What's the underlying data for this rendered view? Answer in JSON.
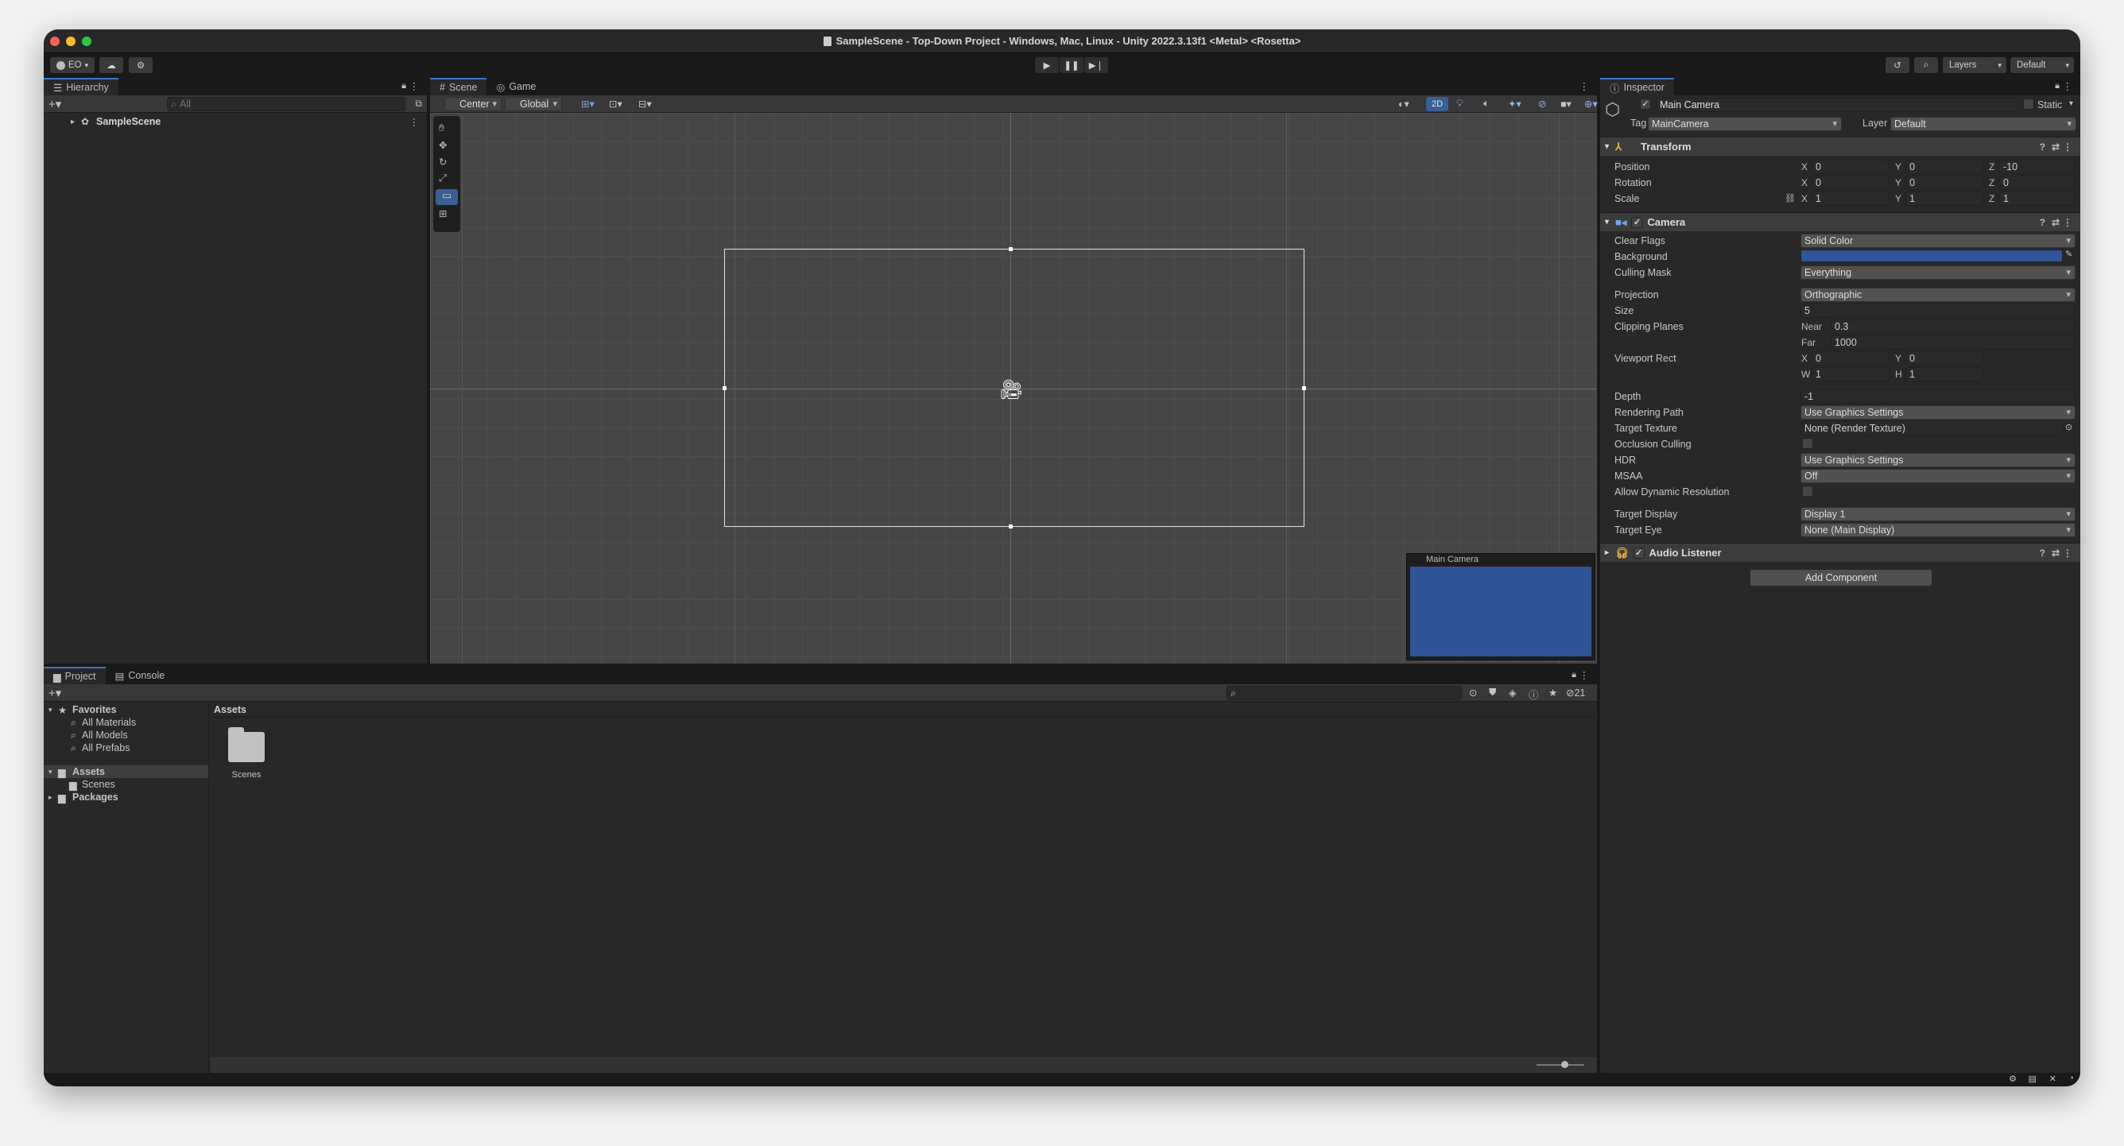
{
  "window": {
    "title": "SampleScene - Top-Down Project - Windows, Mac, Linux - Unity 2022.3.13f1 <Metal> <Rosetta>"
  },
  "toolbar": {
    "account": "EO",
    "layers": "Layers",
    "layout": "Default"
  },
  "hierarchy": {
    "tab": "Hierarchy",
    "search_placeholder": "All",
    "scene_item": "SampleScene"
  },
  "scene_view": {
    "tabs": [
      "Scene",
      "Game"
    ],
    "pivot": "Center",
    "space": "Global",
    "mode_2d": "2D",
    "camera_preview_title": "Main Camera",
    "camera_bg_color": "#2f5497"
  },
  "inspector": {
    "tab": "Inspector",
    "object_name": "Main Camera",
    "static_label": "Static",
    "tag_label": "Tag",
    "tag": "MainCamera",
    "layer_label": "Layer",
    "layer": "Default",
    "transform": {
      "title": "Transform",
      "rows": [
        {
          "label": "Position",
          "x": "0",
          "y": "0",
          "z": "-10"
        },
        {
          "label": "Rotation",
          "x": "0",
          "y": "0",
          "z": "0"
        },
        {
          "label": "Scale",
          "x": "1",
          "y": "1",
          "z": "1"
        }
      ]
    },
    "camera": {
      "title": "Camera",
      "clear_flags": {
        "label": "Clear Flags",
        "value": "Solid Color"
      },
      "background": {
        "label": "Background",
        "color": "#2f5497"
      },
      "culling_mask": {
        "label": "Culling Mask",
        "value": "Everything"
      },
      "projection": {
        "label": "Projection",
        "value": "Orthographic"
      },
      "size": {
        "label": "Size",
        "value": "5"
      },
      "clipping": {
        "label": "Clipping Planes",
        "near_label": "Near",
        "near": "0.3",
        "far_label": "Far",
        "far": "1000"
      },
      "viewport": {
        "label": "Viewport Rect",
        "x": "0",
        "y": "0",
        "w": "1",
        "h": "1"
      },
      "depth": {
        "label": "Depth",
        "value": "-1"
      },
      "rendering_path": {
        "label": "Rendering Path",
        "value": "Use Graphics Settings"
      },
      "target_texture": {
        "label": "Target Texture",
        "value": "None (Render Texture)"
      },
      "occlusion_culling": {
        "label": "Occlusion Culling"
      },
      "hdr": {
        "label": "HDR",
        "value": "Use Graphics Settings"
      },
      "msaa": {
        "label": "MSAA",
        "value": "Off"
      },
      "dynamic_res": {
        "label": "Allow Dynamic Resolution"
      },
      "target_display": {
        "label": "Target Display",
        "value": "Display 1"
      },
      "target_eye": {
        "label": "Target Eye",
        "value": "None (Main Display)"
      }
    },
    "audio_listener": {
      "title": "Audio Listener"
    },
    "add_component": "Add Component"
  },
  "project": {
    "tabs": [
      "Project",
      "Console"
    ],
    "hidden_count": "21",
    "tree": {
      "favorites": "Favorites",
      "fav_items": [
        "All Materials",
        "All Models",
        "All Prefabs"
      ],
      "assets": "Assets",
      "scenes": "Scenes",
      "packages": "Packages"
    },
    "breadcrumb": "Assets",
    "folder": "Scenes"
  }
}
